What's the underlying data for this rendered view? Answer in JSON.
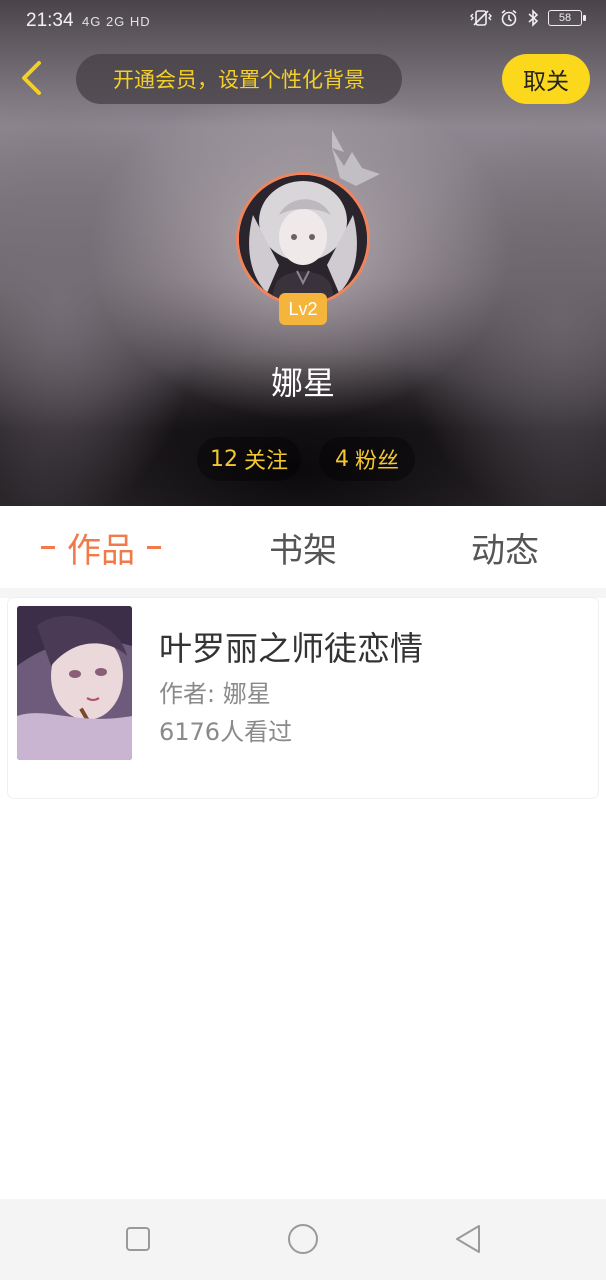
{
  "status_bar": {
    "time": "21:34",
    "network": "4G 2G HD",
    "battery": "58"
  },
  "top_nav": {
    "vip_banner": "开通会员，设置个性化背景",
    "cancel_label": "取关"
  },
  "profile": {
    "level": "Lv2",
    "username": "娜星",
    "follow_count": "12",
    "follow_label": "关注",
    "fans_count": "4",
    "fans_label": "粉丝"
  },
  "tabs": [
    {
      "label": "作品",
      "active": true
    },
    {
      "label": "书架",
      "active": false
    },
    {
      "label": "动态",
      "active": false
    }
  ],
  "works": [
    {
      "title": "叶罗丽之师徒恋情",
      "author": "作者: 娜星",
      "views": "6176人看过"
    }
  ],
  "colors": {
    "accent": "#f07a4a",
    "vip_yellow": "#f4cf2a",
    "cancel_bg": "#fbd81c",
    "level_badge": "#f5b53d"
  },
  "icons": {
    "back": "chevron-left-icon",
    "crown": "crown-icon",
    "nav_recent": "square-icon",
    "nav_home": "circle-icon",
    "nav_back": "triangle-back-icon"
  }
}
